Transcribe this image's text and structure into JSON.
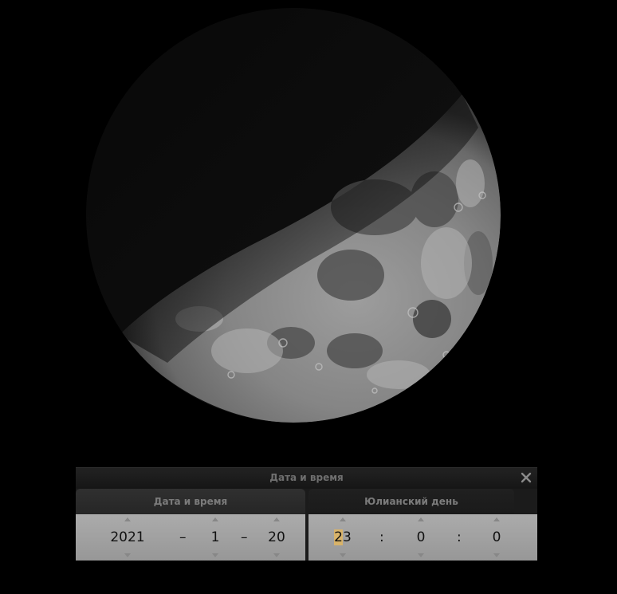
{
  "dialog": {
    "title": "Дата и время",
    "tabs": [
      {
        "label": "Дата и время",
        "active": true
      },
      {
        "label": "Юлианский день",
        "active": false
      }
    ],
    "date": {
      "year": "2021",
      "month": "1",
      "day": "20",
      "separator": "–"
    },
    "time": {
      "hour": "23",
      "minute": "0",
      "second": "0",
      "separator": ":"
    }
  },
  "icons": {
    "close": "close-icon",
    "spin_up": "triangle-up-icon",
    "spin_down": "triangle-down-icon"
  },
  "colors": {
    "background": "#000000",
    "panel": "#a3a3a3",
    "tab_active": "#2c2c2c",
    "cursor_highlight": "#d8b36a"
  }
}
